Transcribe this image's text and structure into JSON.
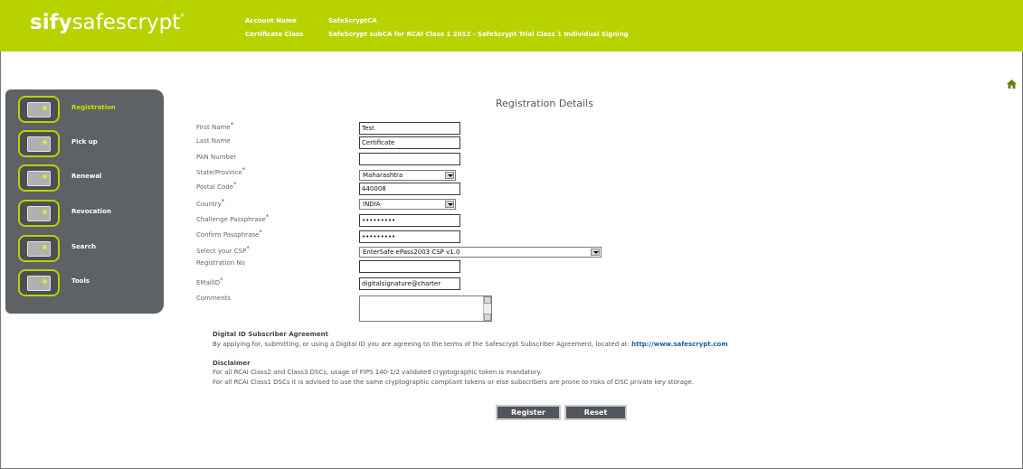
{
  "header": {
    "logo_sify": "sify",
    "logo_rest": "safescrypt",
    "logo_mark": "*",
    "account_label": "Account Name",
    "account_value": "SafeScryptCA",
    "class_label": "Certificate Class",
    "class_value": "SafeScrypt subCA for RCAI Class 1 2012 - SafeScrypt Trial Class 1 Individual Signing"
  },
  "sidebar": {
    "items": [
      {
        "label": "Registration",
        "icon": "registration-icon"
      },
      {
        "label": "Pick up",
        "icon": "pickup-icon"
      },
      {
        "label": "Renewal",
        "icon": "renewal-icon"
      },
      {
        "label": "Revocation",
        "icon": "revocation-icon"
      },
      {
        "label": "Search",
        "icon": "search-icon"
      },
      {
        "label": "Tools",
        "icon": "tools-icon"
      }
    ]
  },
  "form": {
    "title": "Registration Details",
    "required_mark": "*",
    "first_name": {
      "label": "First Name",
      "value": "Test"
    },
    "last_name": {
      "label": "Last Name",
      "value": "Certificate"
    },
    "pan": {
      "label": "PAN Number",
      "value": ""
    },
    "state": {
      "label": "State/Province",
      "value": "Maharashtra"
    },
    "postal": {
      "label": "Postal Code",
      "value": "440008"
    },
    "country": {
      "label": "Country",
      "value": "INDIA"
    },
    "challenge": {
      "label": "Challenge Passphrase",
      "value": "•••••••••"
    },
    "confirm": {
      "label": "Confirm Passphrase",
      "value": "•••••••••"
    },
    "csp": {
      "label": "Select your CSP",
      "value": "EnterSafe ePass2003 CSP v1.0"
    },
    "regno": {
      "label": "Registration No",
      "value": ""
    },
    "email": {
      "label": "EMailID",
      "value": "digitalsignature@charter"
    },
    "comments": {
      "label": "Comments",
      "value": ""
    }
  },
  "agreement": {
    "heading": "Digital ID Subscriber Agreement",
    "text": "By applying for, submitting, or using a Digital ID you are agreeing to the terms of the Safescrypt Subscriber Agreement, located at:",
    "link": "http://www.safescrypt.com"
  },
  "disclaimer": {
    "heading": "Disclaimer",
    "line1": "For all RCAI Class2 and Class3 DSCs, usage of FIPS 140-1/2 validated cryptographic token is mandatory.",
    "line2": "For all RCAI Class1 DSCs it is advised to use the same cryptographic compliant tokens or else subscribers are prone to risks of DSC private key storage."
  },
  "buttons": {
    "register": "Register",
    "reset": "Reset"
  },
  "colors": {
    "header": "#b8d200",
    "sidebar": "#5e6266",
    "accent": "#c8e000",
    "required": "#e0201a"
  }
}
